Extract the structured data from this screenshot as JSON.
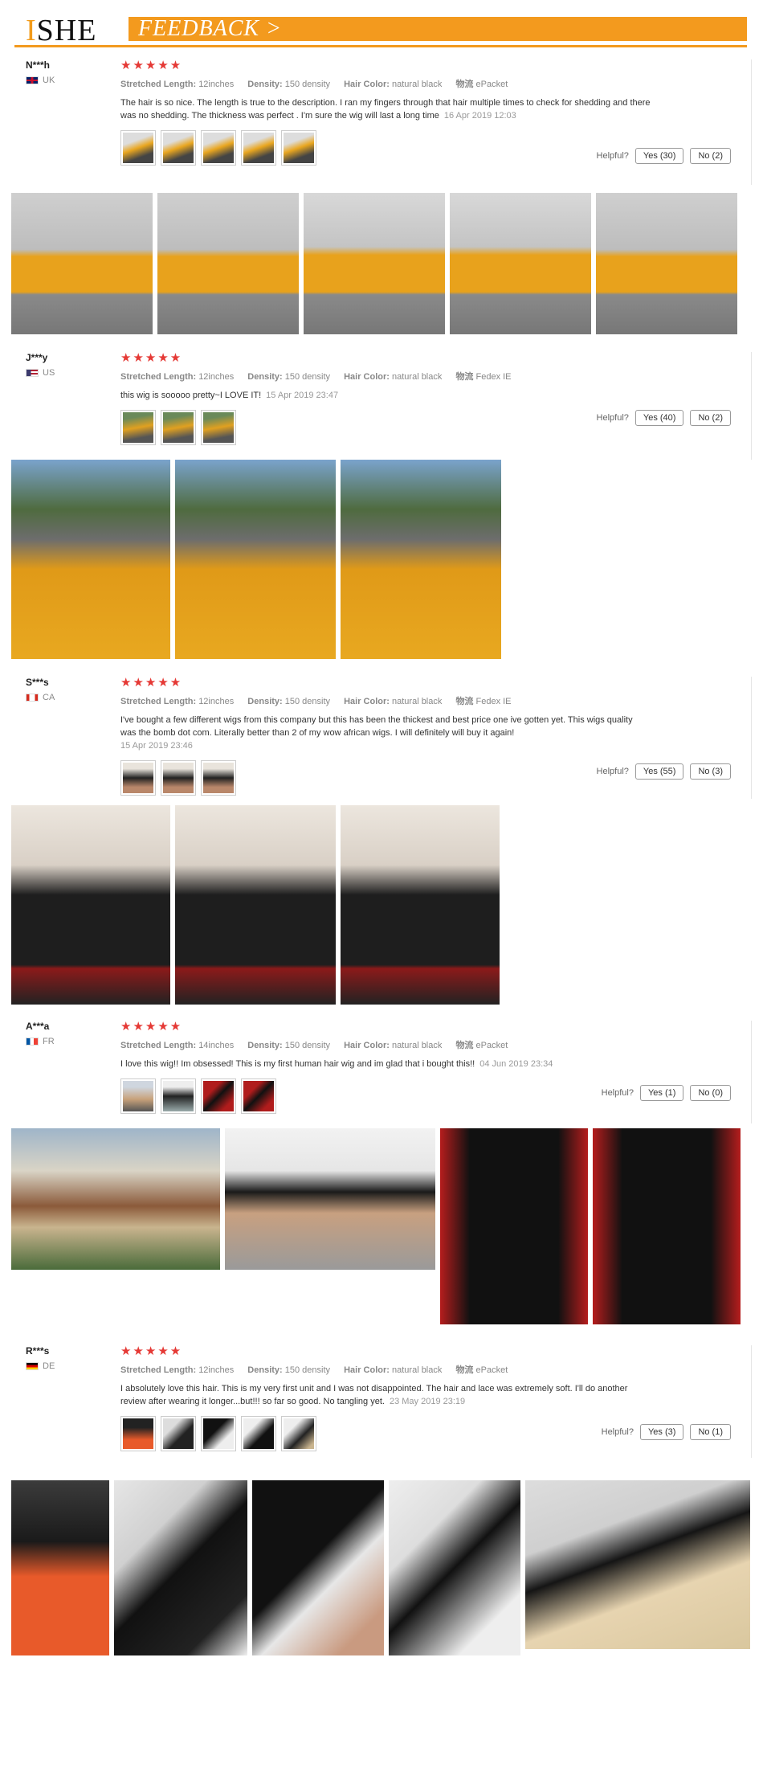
{
  "header": {
    "logo_accent": "I",
    "logo_rest": "SHE",
    "feedback_label": "FEEDBACK >"
  },
  "labels": {
    "stretched_length": "Stretched Length:",
    "density": "Density:",
    "hair_color": "Hair Color:",
    "shipping": "物流",
    "helpful": "Helpful?"
  },
  "reviews": [
    {
      "name": "N***h",
      "country": "UK",
      "stars": "★★★★★",
      "length": "12inches",
      "density": "150 density",
      "color": "natural black",
      "shipping": "ePacket",
      "text": "The hair is so nice. The length is true to the description. I ran my fingers through that hair multiple times to check for shedding and there was no shedding. The thickness was perfect . I'm sure the wig will last a long time",
      "date": "16 Apr 2019 12:03",
      "yes": "Yes (30)",
      "no": "No (2)"
    },
    {
      "name": "J***y",
      "country": "US",
      "stars": "★★★★★",
      "length": "12inches",
      "density": "150 density",
      "color": "natural black",
      "shipping": "Fedex IE",
      "text": "this wig is sooooo pretty~I LOVE IT!",
      "date": "15 Apr 2019 23:47",
      "yes": "Yes (40)",
      "no": "No (2)"
    },
    {
      "name": "S***s",
      "country": "CA",
      "stars": "★★★★★",
      "length": "12inches",
      "density": "150 density",
      "color": "natural black",
      "shipping": "Fedex IE",
      "text": "I've bought a few different wigs from this company but this has been the thickest and best price one ive gotten yet. This wigs quality was the bomb dot com. Literally better than 2 of my wow african wigs. I will definitely will buy it again!",
      "date": "15 Apr 2019 23:46",
      "yes": "Yes (55)",
      "no": "No (3)"
    },
    {
      "name": "A***a",
      "country": "FR",
      "stars": "★★★★★",
      "length": "14inches",
      "density": "150 density",
      "color": "natural black",
      "shipping": "ePacket",
      "text": "I love this wig!! Im obsessed! This is my first human hair wig and im glad that i bought this!!",
      "date": "04 Jun 2019 23:34",
      "yes": "Yes (1)",
      "no": "No (0)"
    },
    {
      "name": "R***s",
      "country": "DE",
      "stars": "★★★★★",
      "length": "12inches",
      "density": "150 density",
      "color": "natural black",
      "shipping": "ePacket",
      "text": "I absolutely love this hair. This is my very first unit and I was not disappointed. The hair and lace was extremely soft. I'll do another review after wearing it longer...but!!! so far so good. No tangling yet.",
      "date": "23 May 2019 23:19",
      "yes": "Yes (3)",
      "no": "No (1)"
    }
  ]
}
